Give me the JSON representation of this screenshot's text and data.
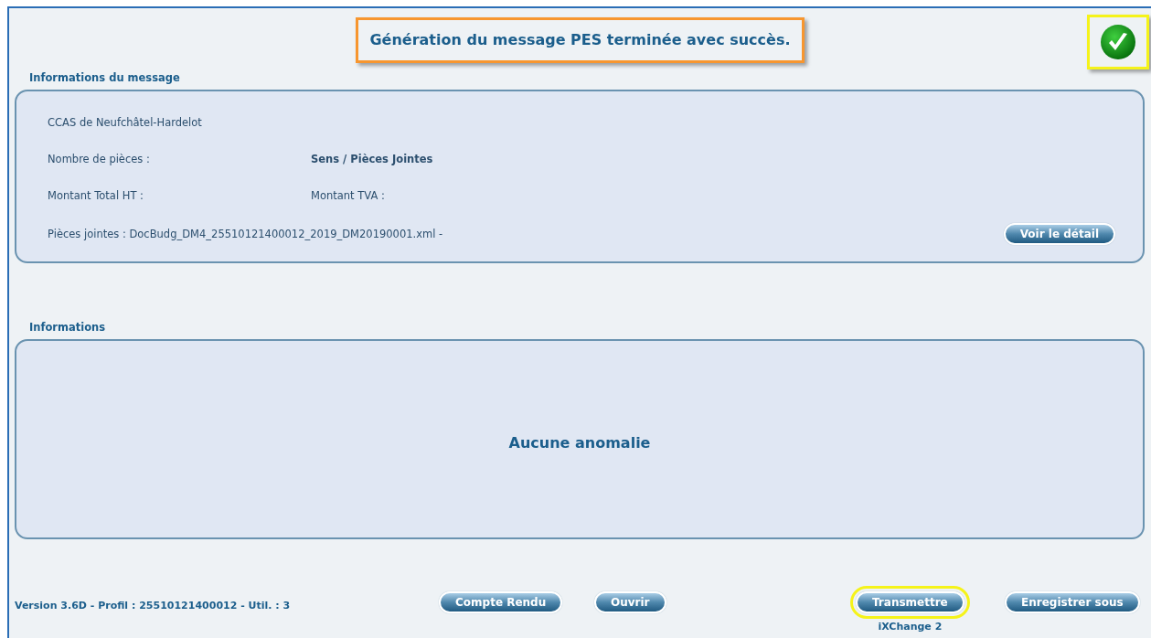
{
  "banner": {
    "text": "Génération du message PES terminée avec succès.",
    "highlighted": true
  },
  "status_icon": {
    "highlighted": true
  },
  "message_section": {
    "title": "Informations du message",
    "organisation": "CCAS de Neufchâtel-Hardelot",
    "pieces_label": "Nombre de pièces :",
    "sens_label": "Sens / Pièces Jointes",
    "total_ht_label": "Montant Total HT :",
    "tva_label": "Montant TVA :",
    "attachments": "Pièces jointes : DocBudg_DM4_25510121400012_2019_DM20190001.xml -",
    "detail_button": "Voir le détail"
  },
  "info_section": {
    "title": "Informations",
    "message": "Aucune anomalie"
  },
  "footer": {
    "version": "Version 3.6D - Profil : 25510121400012 - Util. : 3",
    "buttons": [
      {
        "label": "Compte Rendu",
        "highlighted": false
      },
      {
        "label": "Ouvrir",
        "highlighted": false
      },
      {
        "label": "Transmettre",
        "highlighted": true,
        "caption": "iXChange 2"
      },
      {
        "label": "Enregistrer sous",
        "highlighted": false
      }
    ]
  }
}
